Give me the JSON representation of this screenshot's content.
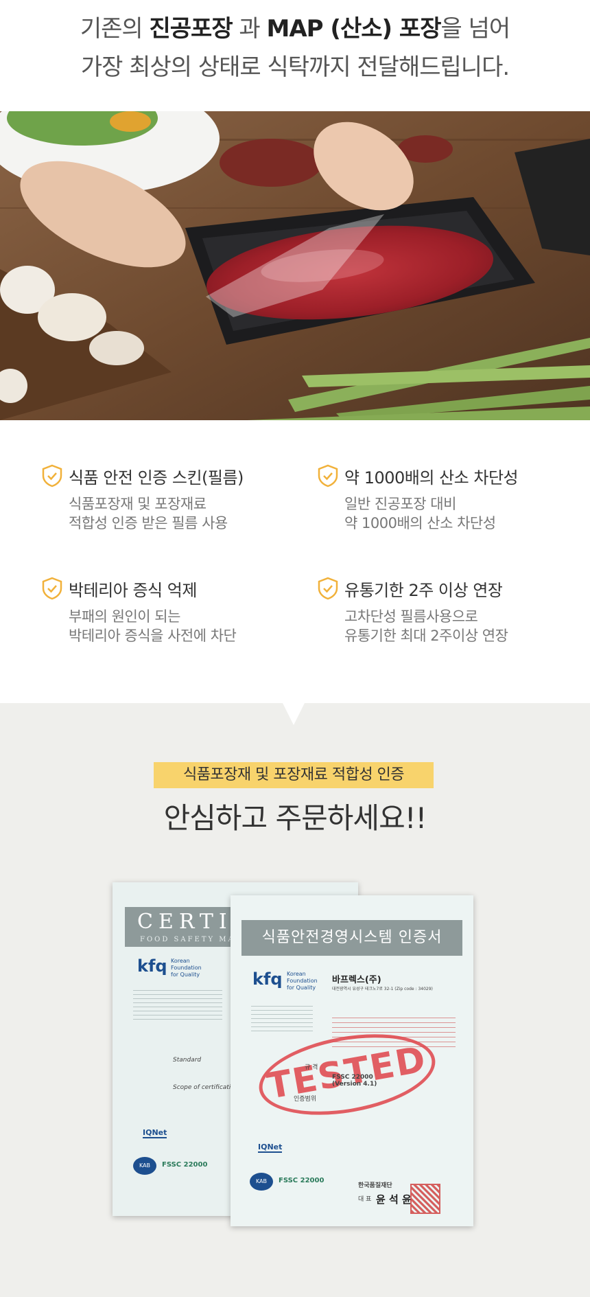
{
  "headline": {
    "line1_pre": "기존의 ",
    "line1_bold1": "진공포장",
    "line1_mid1": " 과 ",
    "line1_bold2": "MAP (산소) 포장",
    "line1_post": "을 넘어",
    "line2": "가장 최상의 상태로 식탁까지 전달해드립니다."
  },
  "features": [
    {
      "title": "식품 안전 인증 스킨(필름)",
      "desc1": "식품포장재 및 포장재료",
      "desc2": "적합성 인증 받은 필름 사용"
    },
    {
      "title": "약 1000배의 산소 차단성",
      "desc1": "일반 진공포장 대비",
      "desc2": "약 1000배의 산소 차단성"
    },
    {
      "title": "박테리아 증식 억제",
      "desc1": "부패의 원인이 되는",
      "desc2": "박테리아 증식을 사전에 차단"
    },
    {
      "title": "유통기한 2주 이상 연장",
      "desc1": "고차단성 필름사용으로",
      "desc2": "유통기한 최대 2주이상 연장"
    }
  ],
  "certification": {
    "badge": "식품포장재 및 포장재료 적합성 인증",
    "headline": "안심하고 주문하세요!!"
  },
  "doc_back": {
    "banner": "CERTI",
    "banner_sub": "FOOD SAFETY MA",
    "kfq": "kfq",
    "kfq_org1": "Korean",
    "kfq_org2": "Foundation",
    "kfq_org3": "for Quality",
    "standard": "Standard",
    "scope": "Scope of certification",
    "iqnet": "IQNet",
    "kab": "KAB",
    "fssc": "FSSC 22000"
  },
  "doc_front": {
    "banner": "식품안전경영시스템 인증서",
    "kfq": "kfq",
    "kfq_org1": "Korean",
    "kfq_org2": "Foundation",
    "kfq_org3": "for Quality",
    "company": "바프렉스(주)",
    "address": "대전광역시 유성구 테크노7로 32-1 (Zip code : 34029)",
    "stamp": "TESTED",
    "standard_label": "규 격",
    "standard_value1": "FSSC 22000",
    "standard_value2": "(Version 4.1)",
    "scope_label": "인증범위",
    "iqnet": "IQNet",
    "kab": "KAB",
    "fssc": "FSSC 22000",
    "issuer": "한국품질재단",
    "ceo_label": "대 표",
    "ceo_name": "윤 석 윤"
  }
}
